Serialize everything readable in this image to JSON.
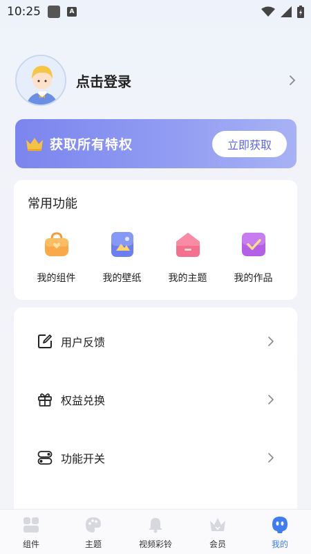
{
  "status_bar": {
    "time": "10:25",
    "a_badge": "A"
  },
  "profile": {
    "login_text": "点击登录"
  },
  "vip_banner": {
    "title": "获取所有特权",
    "button": "立即获取"
  },
  "common_functions": {
    "title": "常用功能",
    "items": [
      {
        "label": "我的组件",
        "icon": "bag-icon"
      },
      {
        "label": "我的壁纸",
        "icon": "wallpaper-icon"
      },
      {
        "label": "我的主题",
        "icon": "theme-home-icon"
      },
      {
        "label": "我的作品",
        "icon": "works-check-icon"
      }
    ]
  },
  "menu": {
    "items": [
      {
        "label": "用户反馈",
        "icon": "edit-icon"
      },
      {
        "label": "权益兑换",
        "icon": "gift-icon"
      },
      {
        "label": "功能开关",
        "icon": "toggle-icon"
      }
    ]
  },
  "bottom_nav": {
    "items": [
      {
        "label": "组件",
        "icon": "widgets-icon"
      },
      {
        "label": "主题",
        "icon": "palette-icon"
      },
      {
        "label": "视频彩铃",
        "icon": "bell-icon"
      },
      {
        "label": "会员",
        "icon": "crown-icon"
      },
      {
        "label": "我的",
        "icon": "mine-icon",
        "active": true
      }
    ]
  },
  "colors": {
    "accent": "#3f7cf0",
    "banner_start": "#7b85ee",
    "banner_end": "#a7b2f5"
  }
}
